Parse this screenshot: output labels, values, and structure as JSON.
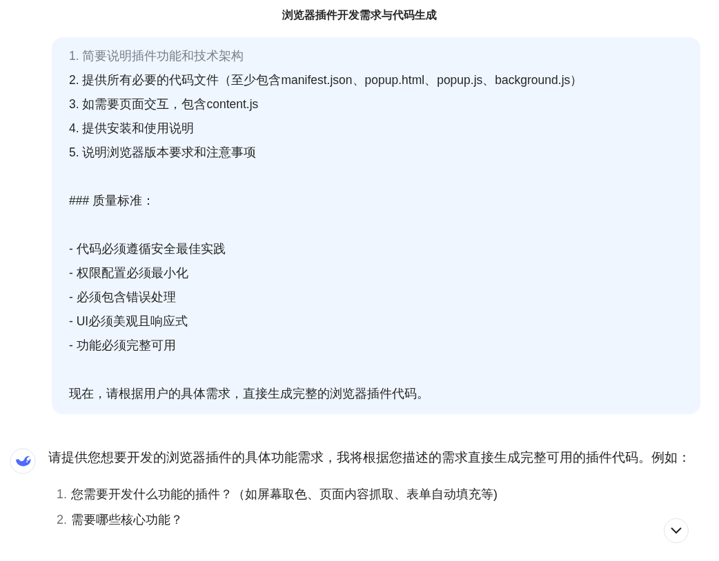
{
  "title": "浏览器插件开发需求与代码生成",
  "prompt_bubble": {
    "groups": [
      {
        "lines": [
          "1. 简要说明插件功能和技术架构",
          "2. 提供所有必要的代码文件（至少包含manifest.json、popup.html、popup.js、background.js）",
          "3. 如需要页面交互，包含content.js",
          "4. 提供安装和使用说明",
          "5. 说明浏览器版本要求和注意事项"
        ]
      },
      {
        "lines": [
          "### 质量标准："
        ]
      },
      {
        "lines": [
          "- 代码必须遵循安全最佳实践",
          "- 权限配置必须最小化",
          "- 必须包含错误处理",
          "- UI必须美观且响应式",
          "- 功能必须完整可用"
        ]
      },
      {
        "lines": [
          "现在，请根据用户的具体需求，直接生成完整的浏览器插件代码。"
        ]
      }
    ]
  },
  "reply": {
    "text": "请提供您想要开发的浏览器插件的具体功能需求，我将根据您描述的需求直接生成完整可用的插件代码。例如：",
    "list": [
      {
        "number": "1.",
        "text": "您需要开发什么功能的插件？（如屏幕取色、页面内容抓取、表单自动填充等)"
      },
      {
        "number": "2.",
        "text": "需要哪些核心功能？"
      }
    ]
  }
}
